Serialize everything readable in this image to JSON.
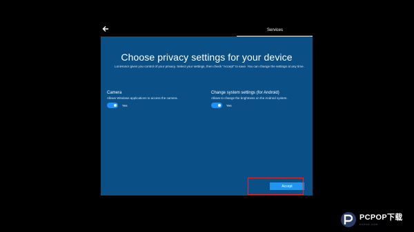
{
  "nav": {
    "back_icon": "back-arrow-icon",
    "tab_label": "Services"
  },
  "dialog": {
    "title": "Choose privacy settings for your device",
    "description": "LoniHonor gives you control of your privacy. Select your settings, then check \"Accept\" to save. You can change the settings at any time.",
    "background_color": "#0a4f86"
  },
  "settings": [
    {
      "title": "Camera",
      "description": "Allows Windows applications to access the camera.",
      "toggle_on": true,
      "toggle_label": "Yes"
    },
    {
      "title": "Change system settings (for Android)",
      "description": "Allows to change the brightness on the Android system.",
      "toggle_on": true,
      "toggle_label": "Yes"
    }
  ],
  "actions": {
    "accept_label": "Accept",
    "accept_color": "#1f95f0",
    "highlight_color": "#e0282d"
  },
  "watermark": {
    "brand": "PCPOP下载",
    "sub": "PCPOP.COM"
  }
}
